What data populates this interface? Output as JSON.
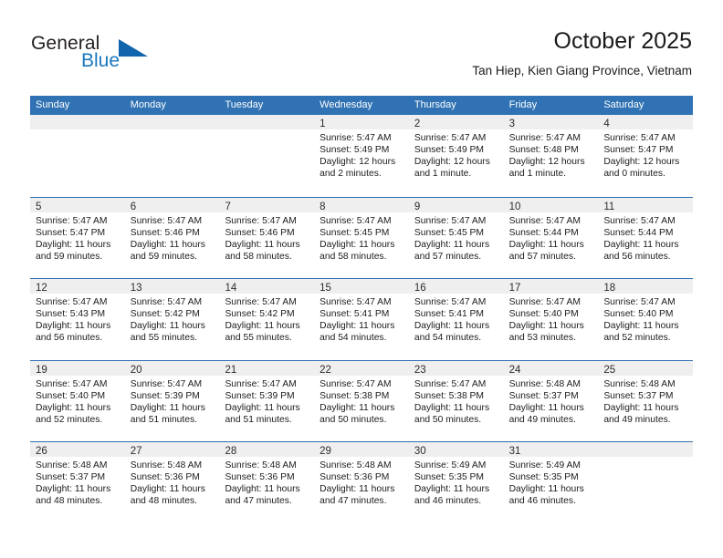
{
  "brand": {
    "name_part1": "General",
    "name_part2": "Blue",
    "triangle_icon": "triangle-logo-icon",
    "color_primary": "#1165ad",
    "color_text": "#231f20"
  },
  "header": {
    "title": "October 2025",
    "subtitle": "Tan Hiep, Kien Giang Province, Vietnam"
  },
  "theme": {
    "header_bg": "#3072b3",
    "header_text": "#ffffff",
    "daynum_band_bg": "#efefef",
    "row_divider": "#2f6fb0",
    "page_bg": "#ffffff"
  },
  "weekdays": [
    "Sunday",
    "Monday",
    "Tuesday",
    "Wednesday",
    "Thursday",
    "Friday",
    "Saturday"
  ],
  "weeks": [
    [
      {
        "day": "",
        "empty": true,
        "sunrise": "",
        "sunset": "",
        "daylight_line1": "",
        "daylight_line2": ""
      },
      {
        "day": "",
        "empty": true,
        "sunrise": "",
        "sunset": "",
        "daylight_line1": "",
        "daylight_line2": ""
      },
      {
        "day": "",
        "empty": true,
        "sunrise": "",
        "sunset": "",
        "daylight_line1": "",
        "daylight_line2": ""
      },
      {
        "day": "1",
        "empty": false,
        "sunrise": "Sunrise: 5:47 AM",
        "sunset": "Sunset: 5:49 PM",
        "daylight_line1": "Daylight: 12 hours",
        "daylight_line2": "and 2 minutes."
      },
      {
        "day": "2",
        "empty": false,
        "sunrise": "Sunrise: 5:47 AM",
        "sunset": "Sunset: 5:49 PM",
        "daylight_line1": "Daylight: 12 hours",
        "daylight_line2": "and 1 minute."
      },
      {
        "day": "3",
        "empty": false,
        "sunrise": "Sunrise: 5:47 AM",
        "sunset": "Sunset: 5:48 PM",
        "daylight_line1": "Daylight: 12 hours",
        "daylight_line2": "and 1 minute."
      },
      {
        "day": "4",
        "empty": false,
        "sunrise": "Sunrise: 5:47 AM",
        "sunset": "Sunset: 5:47 PM",
        "daylight_line1": "Daylight: 12 hours",
        "daylight_line2": "and 0 minutes."
      }
    ],
    [
      {
        "day": "5",
        "empty": false,
        "sunrise": "Sunrise: 5:47 AM",
        "sunset": "Sunset: 5:47 PM",
        "daylight_line1": "Daylight: 11 hours",
        "daylight_line2": "and 59 minutes."
      },
      {
        "day": "6",
        "empty": false,
        "sunrise": "Sunrise: 5:47 AM",
        "sunset": "Sunset: 5:46 PM",
        "daylight_line1": "Daylight: 11 hours",
        "daylight_line2": "and 59 minutes."
      },
      {
        "day": "7",
        "empty": false,
        "sunrise": "Sunrise: 5:47 AM",
        "sunset": "Sunset: 5:46 PM",
        "daylight_line1": "Daylight: 11 hours",
        "daylight_line2": "and 58 minutes."
      },
      {
        "day": "8",
        "empty": false,
        "sunrise": "Sunrise: 5:47 AM",
        "sunset": "Sunset: 5:45 PM",
        "daylight_line1": "Daylight: 11 hours",
        "daylight_line2": "and 58 minutes."
      },
      {
        "day": "9",
        "empty": false,
        "sunrise": "Sunrise: 5:47 AM",
        "sunset": "Sunset: 5:45 PM",
        "daylight_line1": "Daylight: 11 hours",
        "daylight_line2": "and 57 minutes."
      },
      {
        "day": "10",
        "empty": false,
        "sunrise": "Sunrise: 5:47 AM",
        "sunset": "Sunset: 5:44 PM",
        "daylight_line1": "Daylight: 11 hours",
        "daylight_line2": "and 57 minutes."
      },
      {
        "day": "11",
        "empty": false,
        "sunrise": "Sunrise: 5:47 AM",
        "sunset": "Sunset: 5:44 PM",
        "daylight_line1": "Daylight: 11 hours",
        "daylight_line2": "and 56 minutes."
      }
    ],
    [
      {
        "day": "12",
        "empty": false,
        "sunrise": "Sunrise: 5:47 AM",
        "sunset": "Sunset: 5:43 PM",
        "daylight_line1": "Daylight: 11 hours",
        "daylight_line2": "and 56 minutes."
      },
      {
        "day": "13",
        "empty": false,
        "sunrise": "Sunrise: 5:47 AM",
        "sunset": "Sunset: 5:42 PM",
        "daylight_line1": "Daylight: 11 hours",
        "daylight_line2": "and 55 minutes."
      },
      {
        "day": "14",
        "empty": false,
        "sunrise": "Sunrise: 5:47 AM",
        "sunset": "Sunset: 5:42 PM",
        "daylight_line1": "Daylight: 11 hours",
        "daylight_line2": "and 55 minutes."
      },
      {
        "day": "15",
        "empty": false,
        "sunrise": "Sunrise: 5:47 AM",
        "sunset": "Sunset: 5:41 PM",
        "daylight_line1": "Daylight: 11 hours",
        "daylight_line2": "and 54 minutes."
      },
      {
        "day": "16",
        "empty": false,
        "sunrise": "Sunrise: 5:47 AM",
        "sunset": "Sunset: 5:41 PM",
        "daylight_line1": "Daylight: 11 hours",
        "daylight_line2": "and 54 minutes."
      },
      {
        "day": "17",
        "empty": false,
        "sunrise": "Sunrise: 5:47 AM",
        "sunset": "Sunset: 5:40 PM",
        "daylight_line1": "Daylight: 11 hours",
        "daylight_line2": "and 53 minutes."
      },
      {
        "day": "18",
        "empty": false,
        "sunrise": "Sunrise: 5:47 AM",
        "sunset": "Sunset: 5:40 PM",
        "daylight_line1": "Daylight: 11 hours",
        "daylight_line2": "and 52 minutes."
      }
    ],
    [
      {
        "day": "19",
        "empty": false,
        "sunrise": "Sunrise: 5:47 AM",
        "sunset": "Sunset: 5:40 PM",
        "daylight_line1": "Daylight: 11 hours",
        "daylight_line2": "and 52 minutes."
      },
      {
        "day": "20",
        "empty": false,
        "sunrise": "Sunrise: 5:47 AM",
        "sunset": "Sunset: 5:39 PM",
        "daylight_line1": "Daylight: 11 hours",
        "daylight_line2": "and 51 minutes."
      },
      {
        "day": "21",
        "empty": false,
        "sunrise": "Sunrise: 5:47 AM",
        "sunset": "Sunset: 5:39 PM",
        "daylight_line1": "Daylight: 11 hours",
        "daylight_line2": "and 51 minutes."
      },
      {
        "day": "22",
        "empty": false,
        "sunrise": "Sunrise: 5:47 AM",
        "sunset": "Sunset: 5:38 PM",
        "daylight_line1": "Daylight: 11 hours",
        "daylight_line2": "and 50 minutes."
      },
      {
        "day": "23",
        "empty": false,
        "sunrise": "Sunrise: 5:47 AM",
        "sunset": "Sunset: 5:38 PM",
        "daylight_line1": "Daylight: 11 hours",
        "daylight_line2": "and 50 minutes."
      },
      {
        "day": "24",
        "empty": false,
        "sunrise": "Sunrise: 5:48 AM",
        "sunset": "Sunset: 5:37 PM",
        "daylight_line1": "Daylight: 11 hours",
        "daylight_line2": "and 49 minutes."
      },
      {
        "day": "25",
        "empty": false,
        "sunrise": "Sunrise: 5:48 AM",
        "sunset": "Sunset: 5:37 PM",
        "daylight_line1": "Daylight: 11 hours",
        "daylight_line2": "and 49 minutes."
      }
    ],
    [
      {
        "day": "26",
        "empty": false,
        "sunrise": "Sunrise: 5:48 AM",
        "sunset": "Sunset: 5:37 PM",
        "daylight_line1": "Daylight: 11 hours",
        "daylight_line2": "and 48 minutes."
      },
      {
        "day": "27",
        "empty": false,
        "sunrise": "Sunrise: 5:48 AM",
        "sunset": "Sunset: 5:36 PM",
        "daylight_line1": "Daylight: 11 hours",
        "daylight_line2": "and 48 minutes."
      },
      {
        "day": "28",
        "empty": false,
        "sunrise": "Sunrise: 5:48 AM",
        "sunset": "Sunset: 5:36 PM",
        "daylight_line1": "Daylight: 11 hours",
        "daylight_line2": "and 47 minutes."
      },
      {
        "day": "29",
        "empty": false,
        "sunrise": "Sunrise: 5:48 AM",
        "sunset": "Sunset: 5:36 PM",
        "daylight_line1": "Daylight: 11 hours",
        "daylight_line2": "and 47 minutes."
      },
      {
        "day": "30",
        "empty": false,
        "sunrise": "Sunrise: 5:49 AM",
        "sunset": "Sunset: 5:35 PM",
        "daylight_line1": "Daylight: 11 hours",
        "daylight_line2": "and 46 minutes."
      },
      {
        "day": "31",
        "empty": false,
        "sunrise": "Sunrise: 5:49 AM",
        "sunset": "Sunset: 5:35 PM",
        "daylight_line1": "Daylight: 11 hours",
        "daylight_line2": "and 46 minutes."
      },
      {
        "day": "",
        "empty": true,
        "sunrise": "",
        "sunset": "",
        "daylight_line1": "",
        "daylight_line2": ""
      }
    ]
  ]
}
